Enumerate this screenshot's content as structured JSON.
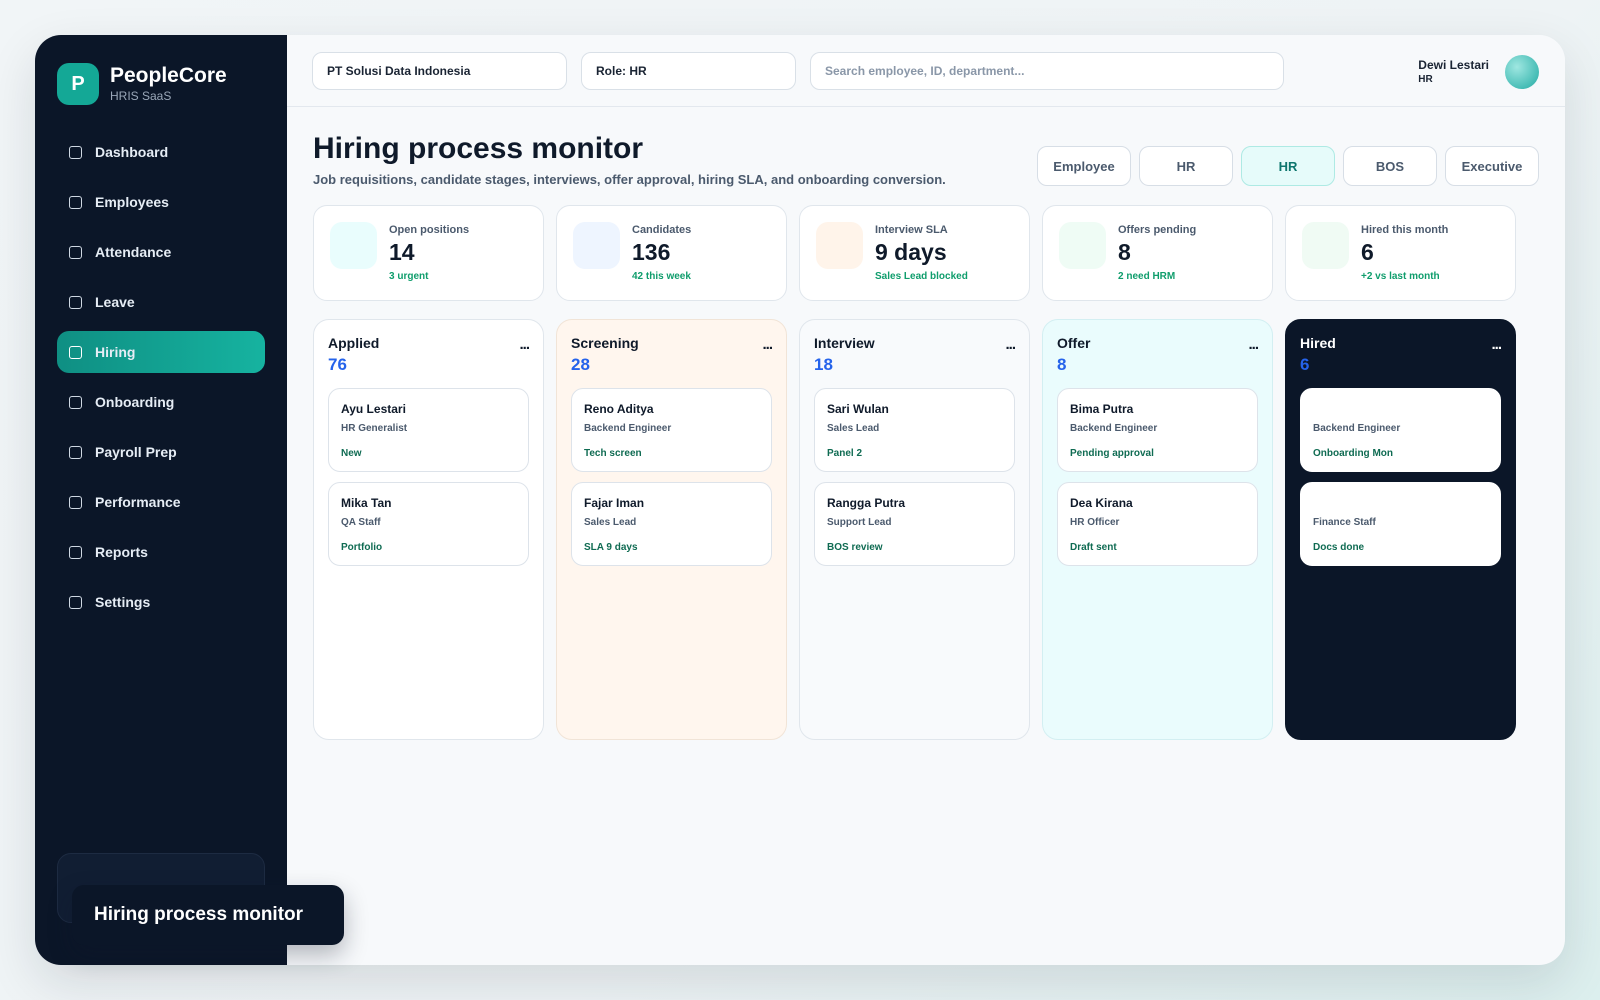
{
  "brand": {
    "initial": "P",
    "name": "PeopleCore",
    "subtitle": "HRIS SaaS"
  },
  "sidebar": {
    "items": [
      {
        "label": "Dashboard",
        "active": false
      },
      {
        "label": "Employees",
        "active": false
      },
      {
        "label": "Attendance",
        "active": false
      },
      {
        "label": "Leave",
        "active": false
      },
      {
        "label": "Hiring",
        "active": true
      },
      {
        "label": "Onboarding",
        "active": false
      },
      {
        "label": "Payroll Prep",
        "active": false
      },
      {
        "label": "Performance",
        "active": false
      },
      {
        "label": "Reports",
        "active": false
      },
      {
        "label": "Settings",
        "active": false
      }
    ]
  },
  "topbar": {
    "company": "PT Solusi Data Indonesia",
    "role": "Role: HR",
    "search_placeholder": "Search employee, ID, department...",
    "user_name": "Dewi Lestari",
    "user_role": "HR"
  },
  "page": {
    "title": "Hiring process monitor",
    "subtitle": "Job requisitions, candidate stages, interviews, offer approval, hiring SLA, and onboarding conversion."
  },
  "role_switch": {
    "options": [
      "Employee",
      "HR",
      "HR",
      "BOS",
      "Executive"
    ],
    "active_index": 2
  },
  "stats": [
    {
      "label": "Open positions",
      "value": "14",
      "note": "3 urgent",
      "icon_color": "#e9fdfd"
    },
    {
      "label": "Candidates",
      "value": "136",
      "note": "42 this week",
      "icon_color": "#eef5ff"
    },
    {
      "label": "Interview SLA",
      "value": "9 days",
      "note": "Sales Lead blocked",
      "icon_color": "#fff4ea"
    },
    {
      "label": "Offers pending",
      "value": "8",
      "note": "2 need HRM",
      "icon_color": "#effcf5"
    },
    {
      "label": "Hired this month",
      "value": "6",
      "note": "+2 vs last month",
      "icon_color": "#f0fbf4"
    }
  ],
  "board": {
    "columns": [
      {
        "title": "Applied",
        "count": "76",
        "more": "...",
        "cards": [
          {
            "name": "Ayu Lestari",
            "role": "HR Generalist",
            "status": "New"
          },
          {
            "name": "Mika Tan",
            "role": "QA Staff",
            "status": "Portfolio"
          }
        ]
      },
      {
        "title": "Screening",
        "count": "28",
        "more": "...",
        "cards": [
          {
            "name": "Reno Aditya",
            "role": "Backend Engineer",
            "status": "Tech screen"
          },
          {
            "name": "Fajar Iman",
            "role": "Sales Lead",
            "status": "SLA 9 days"
          }
        ]
      },
      {
        "title": "Interview",
        "count": "18",
        "more": "...",
        "cards": [
          {
            "name": "Sari Wulan",
            "role": "Sales Lead",
            "status": "Panel 2"
          },
          {
            "name": "Rangga Putra",
            "role": "Support Lead",
            "status": "BOS review"
          }
        ]
      },
      {
        "title": "Offer",
        "count": "8",
        "more": "...",
        "cards": [
          {
            "name": "Bima Putra",
            "role": "Backend Engineer",
            "status": "Pending approval"
          },
          {
            "name": "Dea Kirana",
            "role": "HR Officer",
            "status": "Draft sent"
          }
        ]
      },
      {
        "title": "Hired",
        "count": "6",
        "more": "...",
        "cards": [
          {
            "name": "",
            "role": "Backend Engineer",
            "status": "Onboarding Mon"
          },
          {
            "name": "",
            "role": "Finance Staff",
            "status": "Docs done"
          }
        ]
      }
    ]
  },
  "tooltip": {
    "text": "Hiring process monitor"
  },
  "colors": {
    "accent": "#14a896",
    "sidebar": "#0b1628",
    "count": "#2563eb",
    "positive": "#0f9d6c"
  }
}
